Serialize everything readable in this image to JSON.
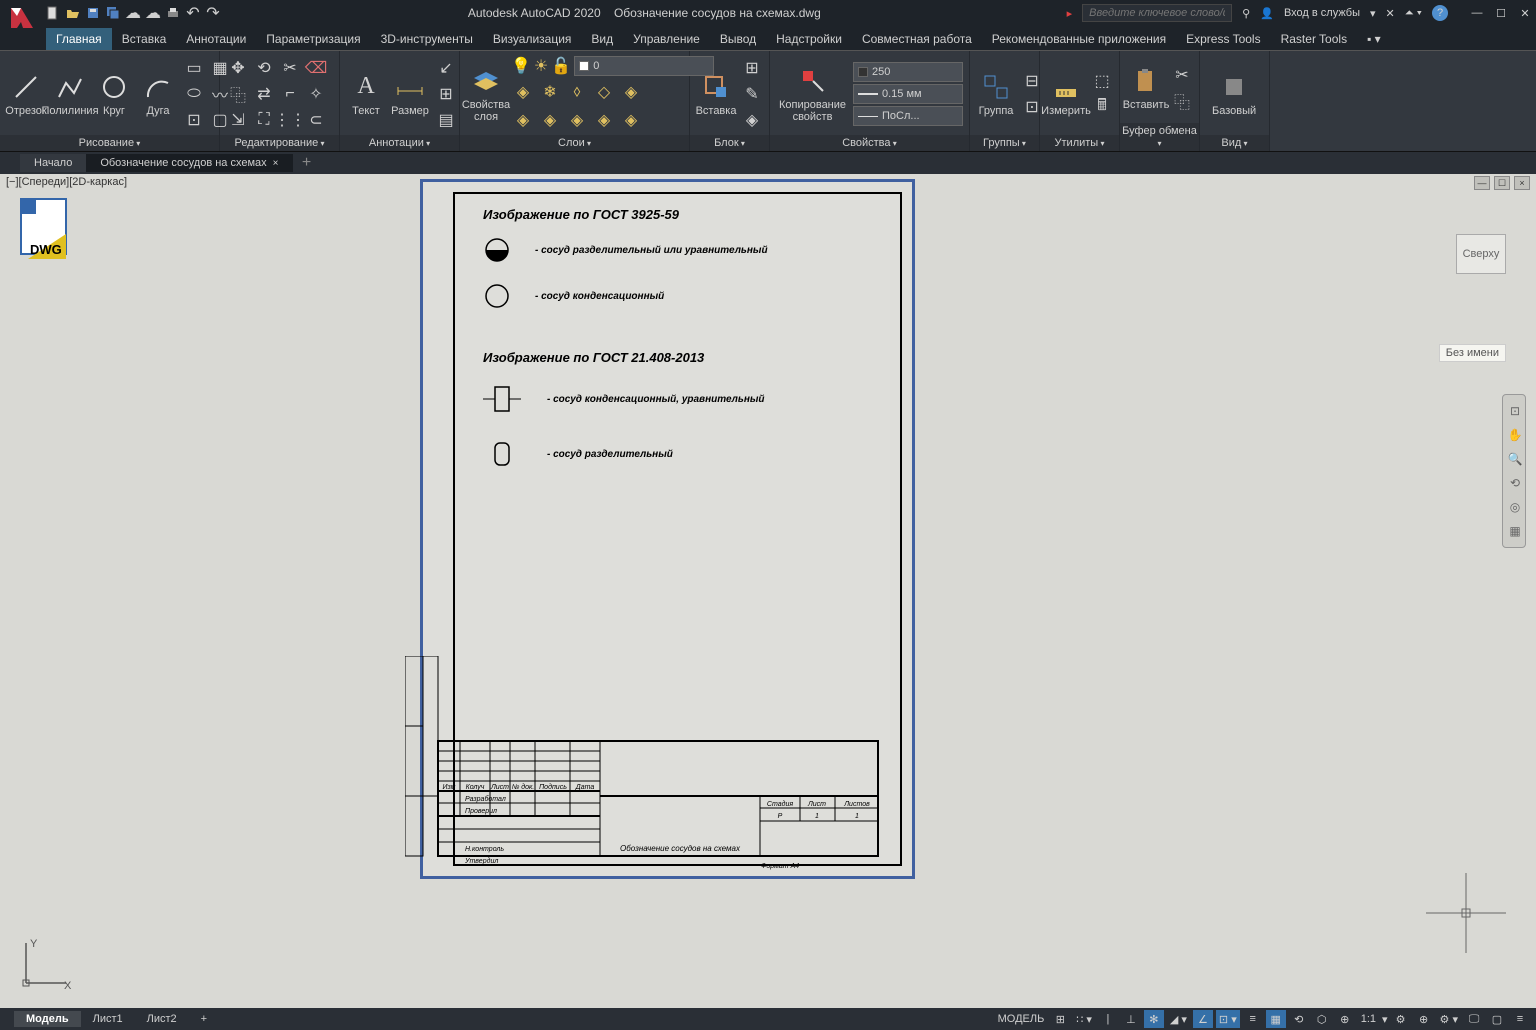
{
  "app": {
    "title": "Autodesk AutoCAD 2020",
    "document": "Обозначение сосудов на схемах.dwg"
  },
  "search": {
    "placeholder": "Введите ключевое слово/фразу"
  },
  "login": {
    "label": "Вход в службы"
  },
  "ribbon_tabs": {
    "home": "Главная",
    "insert": "Вставка",
    "annotate": "Аннотации",
    "param": "Параметризация",
    "tools3d": "3D-инструменты",
    "viz": "Визуализация",
    "view": "Вид",
    "manage": "Управление",
    "output": "Вывод",
    "addins": "Надстройки",
    "collab": "Совместная работа",
    "recommend": "Рекомендованные приложения",
    "express": "Express Tools",
    "raster": "Raster Tools"
  },
  "panels": {
    "draw": "Рисование",
    "modify": "Редактирование",
    "annot": "Аннотации",
    "layers": "Слои",
    "block": "Блок",
    "props": "Свойства",
    "groups": "Группы",
    "utils": "Утилиты",
    "clip": "Буфер обмена",
    "view": "Вид"
  },
  "buttons": {
    "line": "Отрезок",
    "pline": "Полилиния",
    "circle": "Круг",
    "arc": "Дуга",
    "text": "Текст",
    "dim": "Размер",
    "layerprops": "Свойства слоя",
    "insert": "Вставка",
    "matchprops": "Копирование свойств",
    "group": "Группа",
    "measure": "Измерить",
    "paste": "Вставить",
    "base": "Базовый"
  },
  "layer": {
    "current": "0"
  },
  "props": {
    "color": "250",
    "lw": "0.15 мм",
    "lt": "ПоСл..."
  },
  "file_tabs": {
    "start": "Начало",
    "doc": "Обозначение сосудов на схемах"
  },
  "viewport": {
    "label": "[−][Спереди][2D-каркас]",
    "cube": "Сверху",
    "layer_badge": "Без имени"
  },
  "drawing": {
    "gost1_title": "Изображение по ГОСТ 3925-59",
    "gost1_item1": "- сосуд разделительный или уравнительный",
    "gost1_item2": "- сосуд конденсационный",
    "gost2_title": "Изображение по ГОСТ 21.408-2013",
    "gost2_item1": "- сосуд конденсационный, уравнительный",
    "gost2_item2": "- сосуд разделительный",
    "stamp_title": "Обозначение сосудов на схемах",
    "stamp": {
      "izm": "Изм",
      "kuch": "Колуч",
      "list": "Лист",
      "ndok": "№ док.",
      "podpis": "Подпись",
      "data": "Дата",
      "razrab": "Разработал",
      "proveril": "Проверил",
      "nkontr": "Н.контроль",
      "utverd": "Утвердил",
      "stadia": "Стадия",
      "list2": "Лист",
      "listov": "Листов",
      "val_stadia": "Р",
      "val_list": "1",
      "val_listov": "1",
      "format": "Формат А4"
    }
  },
  "bottom_tabs": {
    "model": "Модель",
    "l1": "Лист1",
    "l2": "Лист2"
  },
  "status": {
    "model": "МОДЕЛЬ",
    "scale": "1:1"
  }
}
